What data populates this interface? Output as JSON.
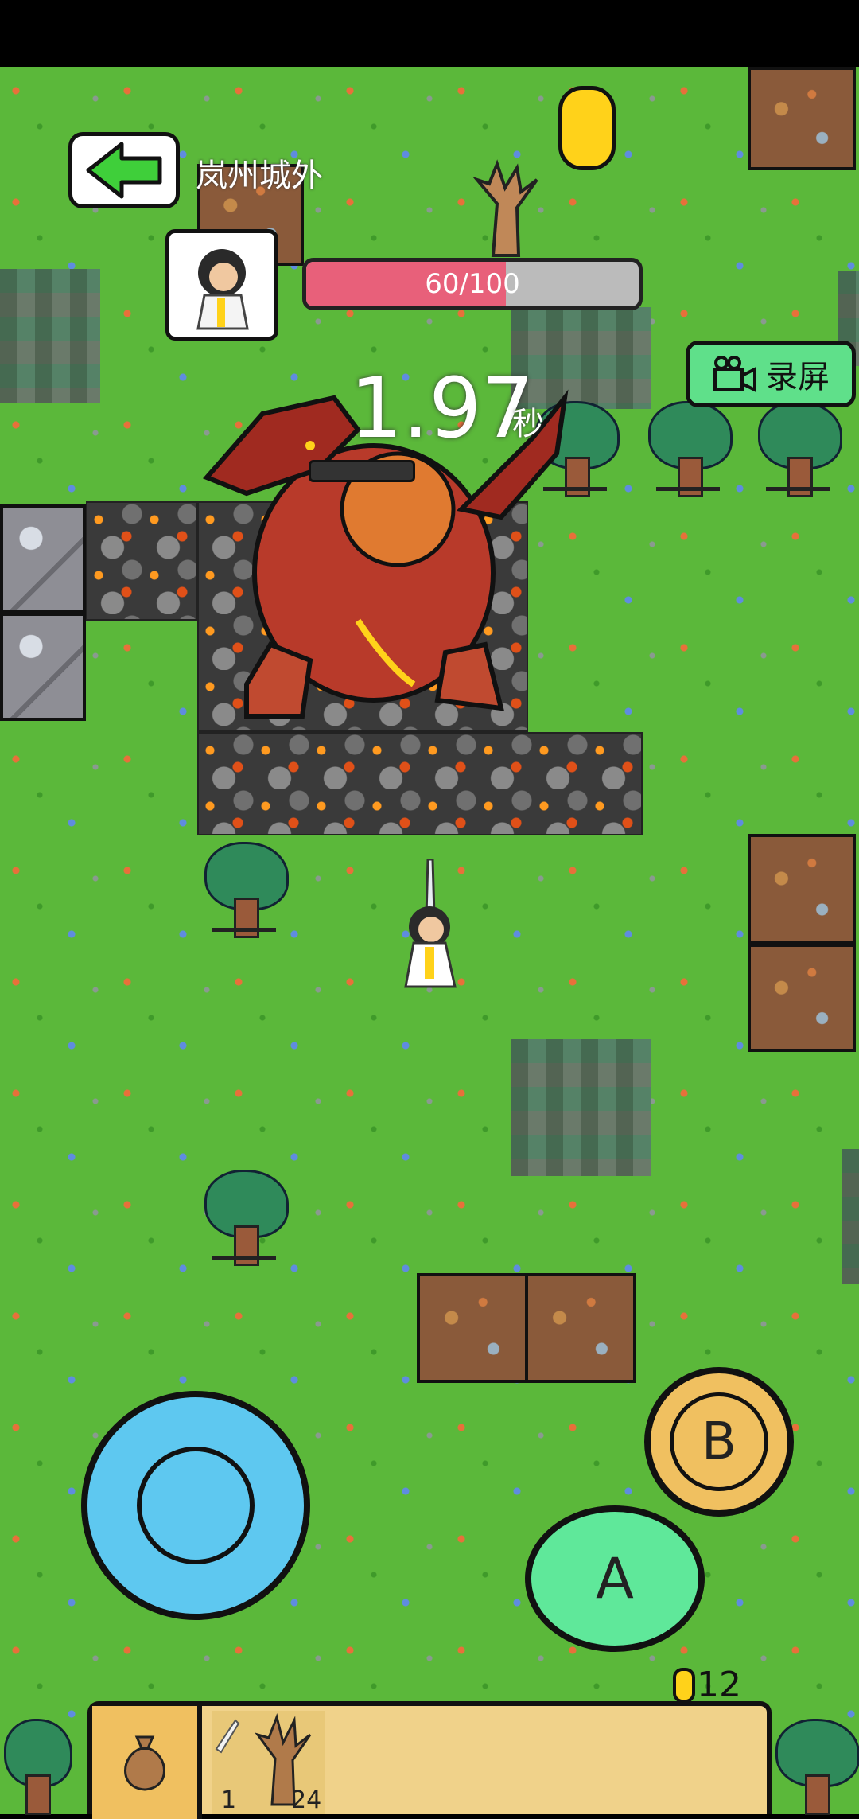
{
  "header": {
    "area_name": "岚州城外",
    "back_icon": "arrow-left-icon"
  },
  "player": {
    "hp_current": 60,
    "hp_max": 100,
    "hp_text": "60/100",
    "hp_fraction": 0.6,
    "portrait_icon": "hero-portrait-icon"
  },
  "record": {
    "label": "录屏",
    "icon": "video-camera-icon"
  },
  "countdown": {
    "value": "1.97",
    "unit": "秒"
  },
  "controls": {
    "button_a": "A",
    "button_b": "B"
  },
  "currency": {
    "coins": "12"
  },
  "inventory": {
    "bag_icon": "money-bag-icon",
    "slots": [
      {
        "icon": "sword-icon",
        "count": "1"
      },
      {
        "icon": "dead-tree-icon",
        "count": "24"
      }
    ]
  },
  "colors": {
    "grass": "#5bb83a",
    "hp_fill": "#e8607a",
    "joystick": "#5ec8f0",
    "button_a": "#5fe89a",
    "button_b": "#f0c060",
    "coin": "#ffd21a",
    "inventory": "#f0d28a"
  }
}
